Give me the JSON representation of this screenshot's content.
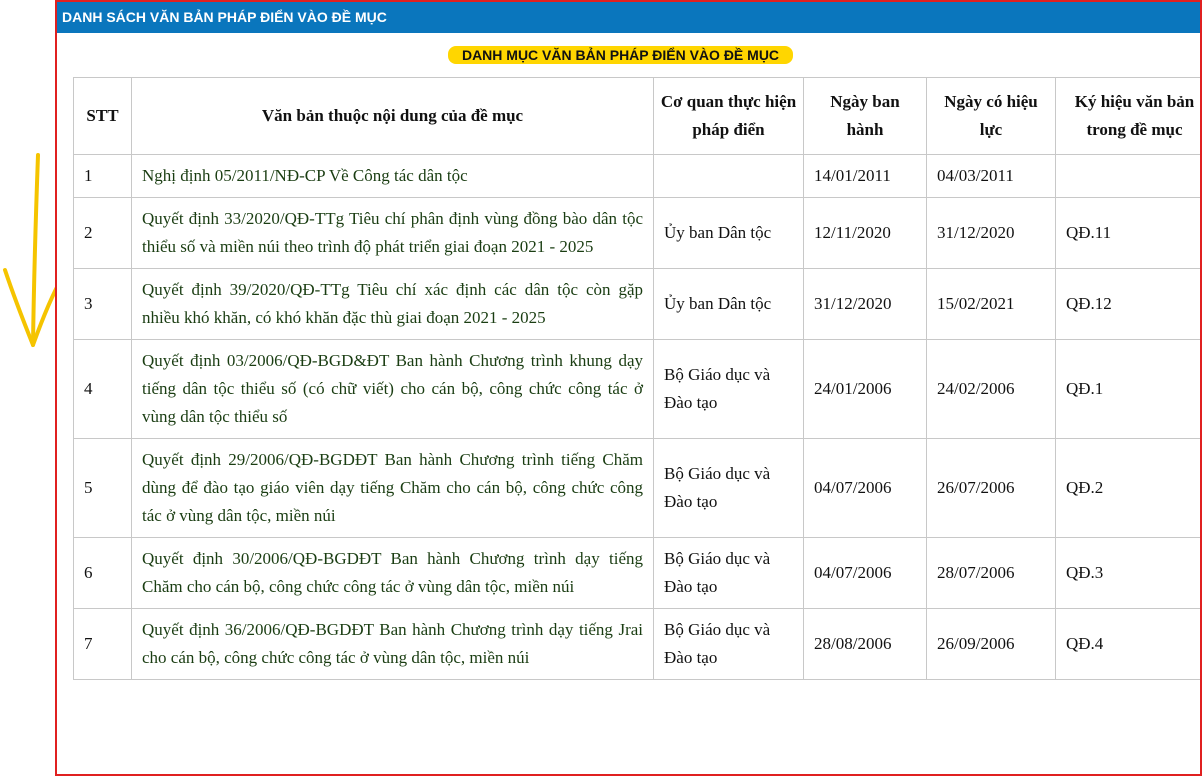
{
  "header": {
    "title": "DANH SÁCH VĂN BẢN PHÁP ĐIỂN VÀO ĐỀ MỤC"
  },
  "subtitle": "DANH MỤC VĂN BẢN PHÁP ĐIỂN VÀO ĐỀ MỤC",
  "highlight_color": "#ffd600",
  "header_color": "#0a76bd",
  "table": {
    "columns": [
      "STT",
      "Văn bản thuộc nội dung của đề mục",
      "Cơ quan thực hiện pháp điển",
      "Ngày ban hành",
      "Ngày có hiệu lực",
      "Ký hiệu văn bản trong đề mục"
    ],
    "rows": [
      {
        "stt": "1",
        "doc": "Nghị định 05/2011/NĐ-CP Về Công tác dân tộc",
        "agency": "",
        "issued": "14/01/2011",
        "effective": "04/03/2011",
        "code": ""
      },
      {
        "stt": "2",
        "doc": "Quyết định 33/2020/QĐ-TTg Tiêu chí phân định vùng đồng bào dân tộc thiểu số và miền núi theo trình độ phát triển giai đoạn 2021 - 2025",
        "agency": "Ủy ban Dân tộc",
        "issued": "12/11/2020",
        "effective": "31/12/2020",
        "code": "QĐ.11"
      },
      {
        "stt": "3",
        "doc": "Quyết định 39/2020/QĐ-TTg Tiêu chí xác định các dân tộc còn gặp nhiều khó khăn, có khó khăn đặc thù giai đoạn 2021 - 2025",
        "agency": "Ủy ban Dân tộc",
        "issued": "31/12/2020",
        "effective": "15/02/2021",
        "code": "QĐ.12"
      },
      {
        "stt": "4",
        "doc": "Quyết định 03/2006/QĐ-BGD&ĐT Ban hành Chương trình khung dạy tiếng dân tộc thiểu số (có chữ viết) cho cán bộ, công chức công tác ở vùng dân tộc thiểu số",
        "agency": "Bộ Giáo dục và Đào tạo",
        "issued": "24/01/2006",
        "effective": "24/02/2006",
        "code": "QĐ.1"
      },
      {
        "stt": "5",
        "doc": "Quyết định 29/2006/QĐ-BGDĐT Ban hành Chương trình tiếng Chăm dùng để đào tạo giáo viên dạy tiếng Chăm cho cán bộ, công chức công tác ở vùng dân tộc, miền núi",
        "agency": "Bộ Giáo dục và Đào tạo",
        "issued": "04/07/2006",
        "effective": "26/07/2006",
        "code": "QĐ.2"
      },
      {
        "stt": "6",
        "doc": "Quyết định 30/2006/QĐ-BGDĐT Ban hành Chương trình dạy tiếng Chăm cho cán bộ, công chức công tác ở vùng dân tộc, miền núi",
        "agency": "Bộ Giáo dục và Đào tạo",
        "issued": "04/07/2006",
        "effective": "28/07/2006",
        "code": "QĐ.3"
      },
      {
        "stt": "7",
        "doc": "Quyết định 36/2006/QĐ-BGDĐT Ban hành Chương trình dạy tiếng Jrai cho cán bộ, công chức công tác ở vùng dân tộc, miền núi",
        "agency": "Bộ Giáo dục và Đào tạo",
        "issued": "28/08/2006",
        "effective": "26/09/2006",
        "code": "QĐ.4"
      }
    ]
  }
}
